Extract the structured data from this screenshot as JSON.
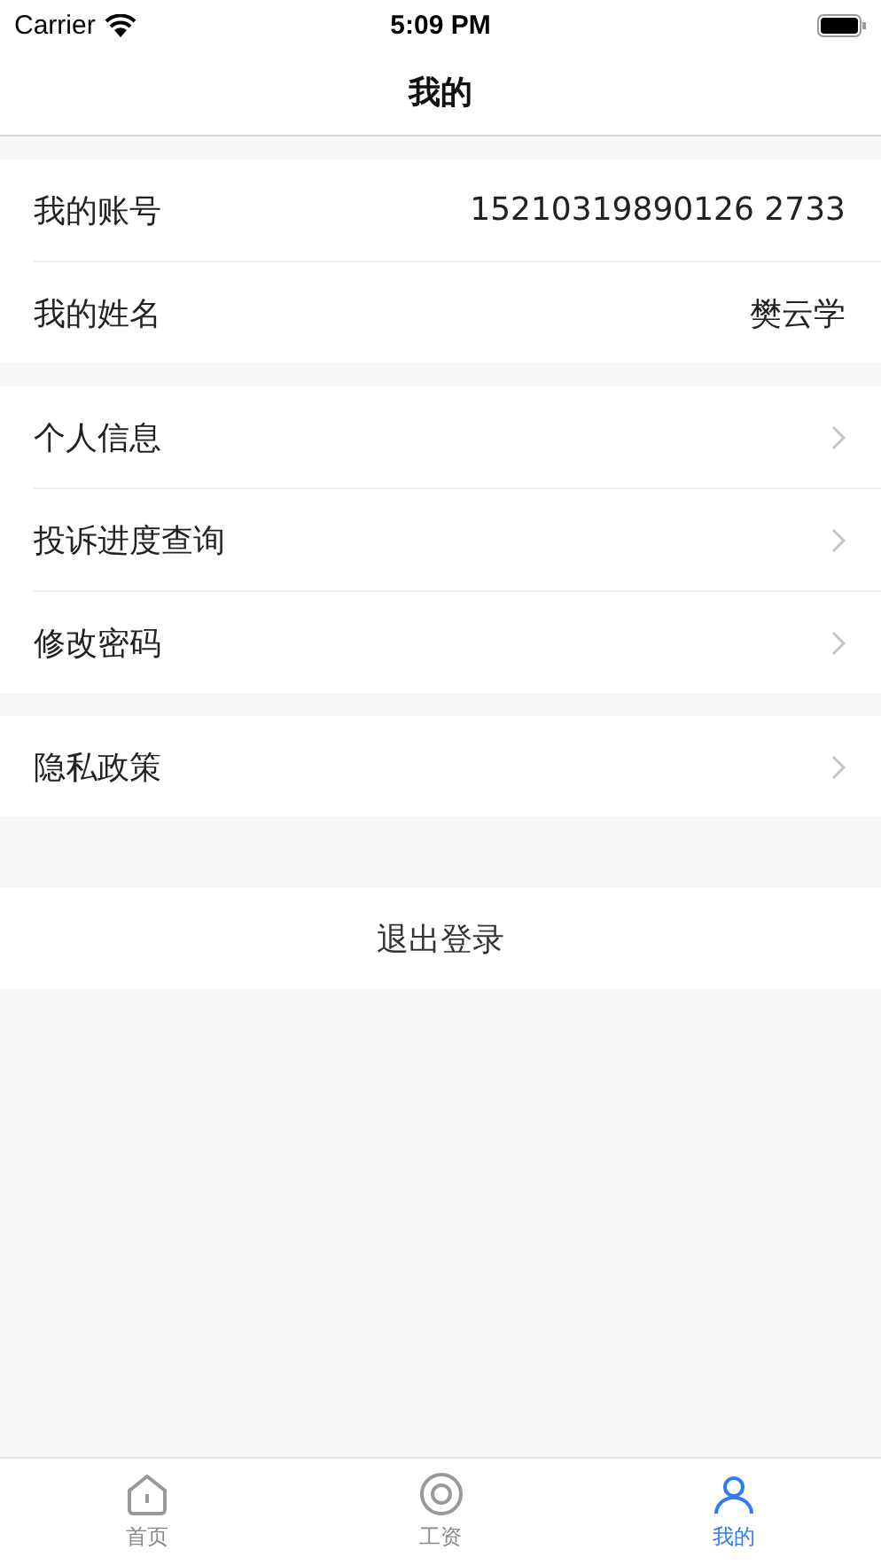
{
  "status_bar": {
    "carrier": "Carrier",
    "time": "5:09 PM"
  },
  "nav": {
    "title": "我的"
  },
  "groups": [
    {
      "rows": [
        {
          "kind": "value",
          "label": "我的账号",
          "value": "15210319890126 2733"
        },
        {
          "kind": "value",
          "label": "我的姓名",
          "value": "樊云学"
        }
      ]
    },
    {
      "rows": [
        {
          "kind": "link",
          "label": "个人信息"
        },
        {
          "kind": "link",
          "label": "投诉进度查询"
        },
        {
          "kind": "link",
          "label": "修改密码"
        }
      ]
    },
    {
      "rows": [
        {
          "kind": "link",
          "label": "隐私政策"
        }
      ]
    }
  ],
  "logout": {
    "label": "退出登录"
  },
  "tabs": [
    {
      "kind": "home",
      "label": "首页",
      "selected": false
    },
    {
      "kind": "salary",
      "label": "工资",
      "selected": false
    },
    {
      "kind": "me",
      "label": "我的",
      "selected": true
    }
  ]
}
